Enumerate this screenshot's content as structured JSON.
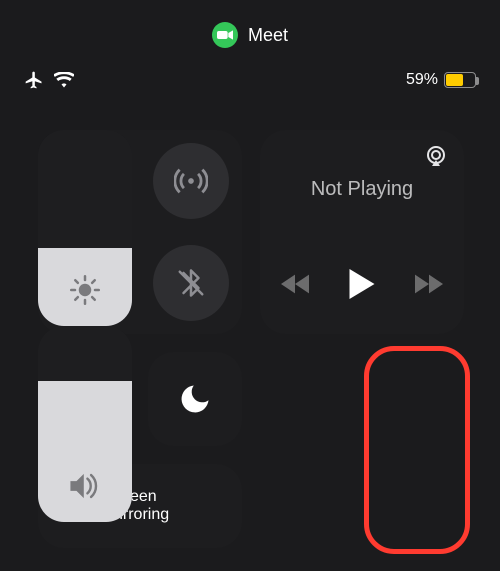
{
  "status": {
    "app_name": "Meet",
    "battery_percent_label": "59%",
    "battery_percent": 59,
    "battery_color": "#ffcc00"
  },
  "connectivity": {
    "airplane_on": true,
    "cellular_on": false,
    "wifi_on": true,
    "bluetooth_on": false
  },
  "media": {
    "title": "Not Playing"
  },
  "tiles": {
    "screen_mirroring_label": "Screen\nMirroring"
  },
  "sliders": {
    "brightness_percent": 40,
    "volume_percent": 72
  }
}
